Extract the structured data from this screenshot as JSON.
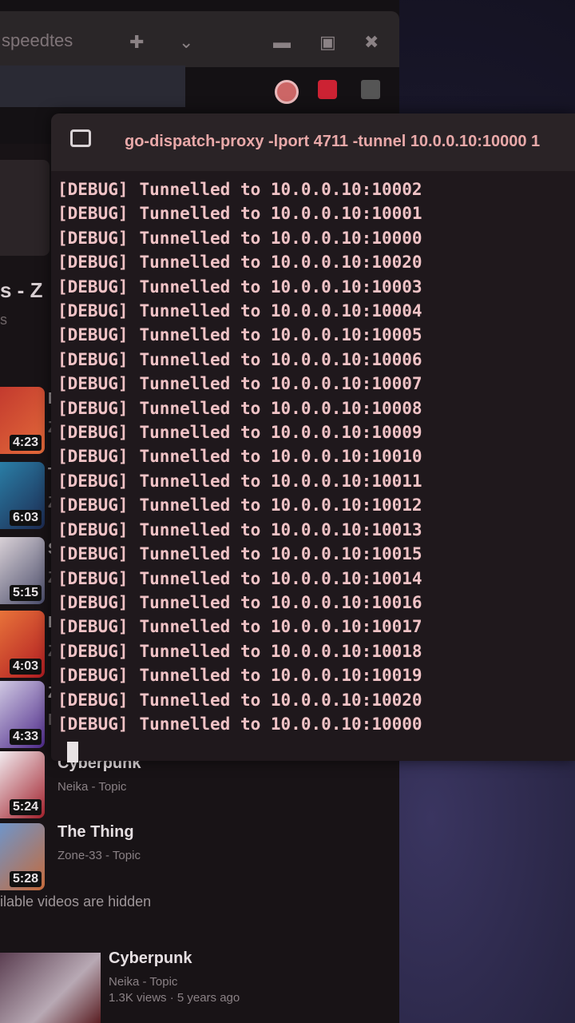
{
  "browser": {
    "tab_title": "speedtes",
    "tab_add_icon": "plus-icon",
    "tab_menu_icon": "chevron-down-icon",
    "window_controls": [
      "minimize-icon",
      "maximize-icon",
      "close-icon"
    ]
  },
  "playlist": {
    "title_fragment": "s - Z",
    "items": [
      {
        "duration": "4:23",
        "letter": "M",
        "sub_letter": "Z"
      },
      {
        "duration": "6:03",
        "letter": "T",
        "sub_letter": "Z"
      },
      {
        "duration": "5:15",
        "letter": "S",
        "sub_letter": "Z"
      },
      {
        "duration": "4:03",
        "letter": "D",
        "sub_letter": "Z"
      },
      {
        "duration": "4:33",
        "letter": "Z",
        "sub_letter": "N"
      },
      {
        "duration": "5:24",
        "title": "Cyberpunk",
        "channel": "Neika - Topic"
      },
      {
        "duration": "5:28",
        "title": "The Thing",
        "channel": "Zone-33 - Topic"
      }
    ],
    "hidden_note": "ilable videos are hidden",
    "recommended": {
      "title": "Cyberpunk",
      "channel": "Neika - Topic",
      "meta": "1.3K views · 5 years ago"
    }
  },
  "terminal": {
    "icon": "terminal-icon",
    "title": "go-dispatch-proxy -lport 4711 -tunnel 10.0.0.10:10000 1",
    "log_level": "[DEBUG]",
    "message": "Tunnelled to",
    "targets": [
      "10.0.0.10:10002",
      "10.0.0.10:10001",
      "10.0.0.10:10000",
      "10.0.0.10:10020",
      "10.0.0.10:10003",
      "10.0.0.10:10004",
      "10.0.0.10:10005",
      "10.0.0.10:10006",
      "10.0.0.10:10007",
      "10.0.0.10:10008",
      "10.0.0.10:10009",
      "10.0.0.10:10010",
      "10.0.0.10:10011",
      "10.0.0.10:10012",
      "10.0.0.10:10013",
      "10.0.0.10:10015",
      "10.0.0.10:10014",
      "10.0.0.10:10016",
      "10.0.0.10:10017",
      "10.0.0.10:10018",
      "10.0.0.10:10019",
      "10.0.0.10:10020",
      "10.0.0.10:10000"
    ]
  }
}
